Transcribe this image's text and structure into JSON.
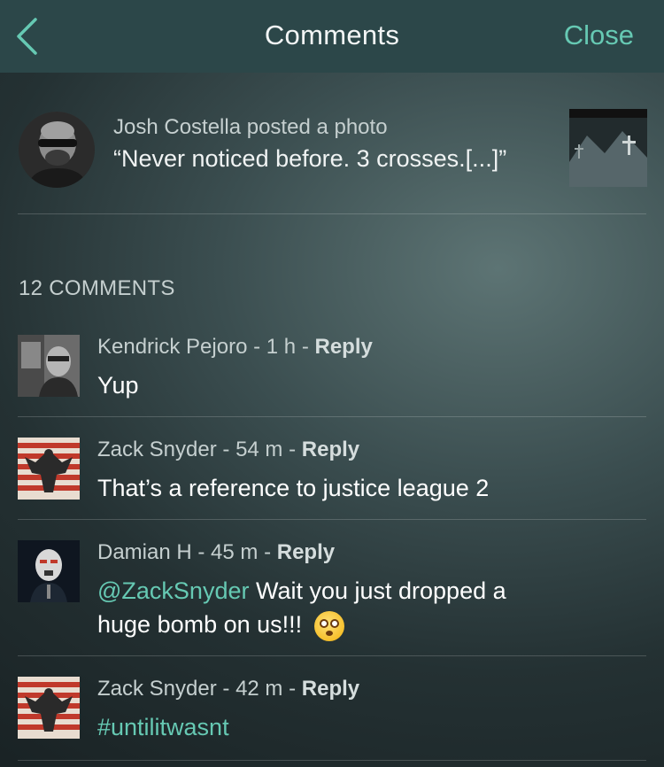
{
  "nav": {
    "title": "Comments",
    "close_label": "Close",
    "back_icon": "chevron-left-icon",
    "bar_color": "#2c4749",
    "accent_color": "#66c9b3"
  },
  "post": {
    "meta": "Josh Costella posted a photo",
    "caption": "“Never noticed before. 3 crosses.[...]”"
  },
  "comments_header": "12 COMMENTS",
  "comments": [
    {
      "author": "Kendrick Pejoro",
      "time": "1 h",
      "reply_label": "Reply",
      "text": "Yup"
    },
    {
      "author": "Zack Snyder",
      "time": "54 m",
      "reply_label": "Reply",
      "text": "That’s a reference to justice league 2"
    },
    {
      "author": "Damian H",
      "time": "45 m",
      "reply_label": "Reply",
      "mention": "@ZackSnyder",
      "text_line1": " Wait you just dropped a",
      "text_line2": "huge bomb on us!!!",
      "emoji": "flushed-face-emoji"
    },
    {
      "author": "Zack Snyder",
      "time": "42 m",
      "reply_label": "Reply",
      "hashtag": "#untilitwasnt"
    }
  ]
}
